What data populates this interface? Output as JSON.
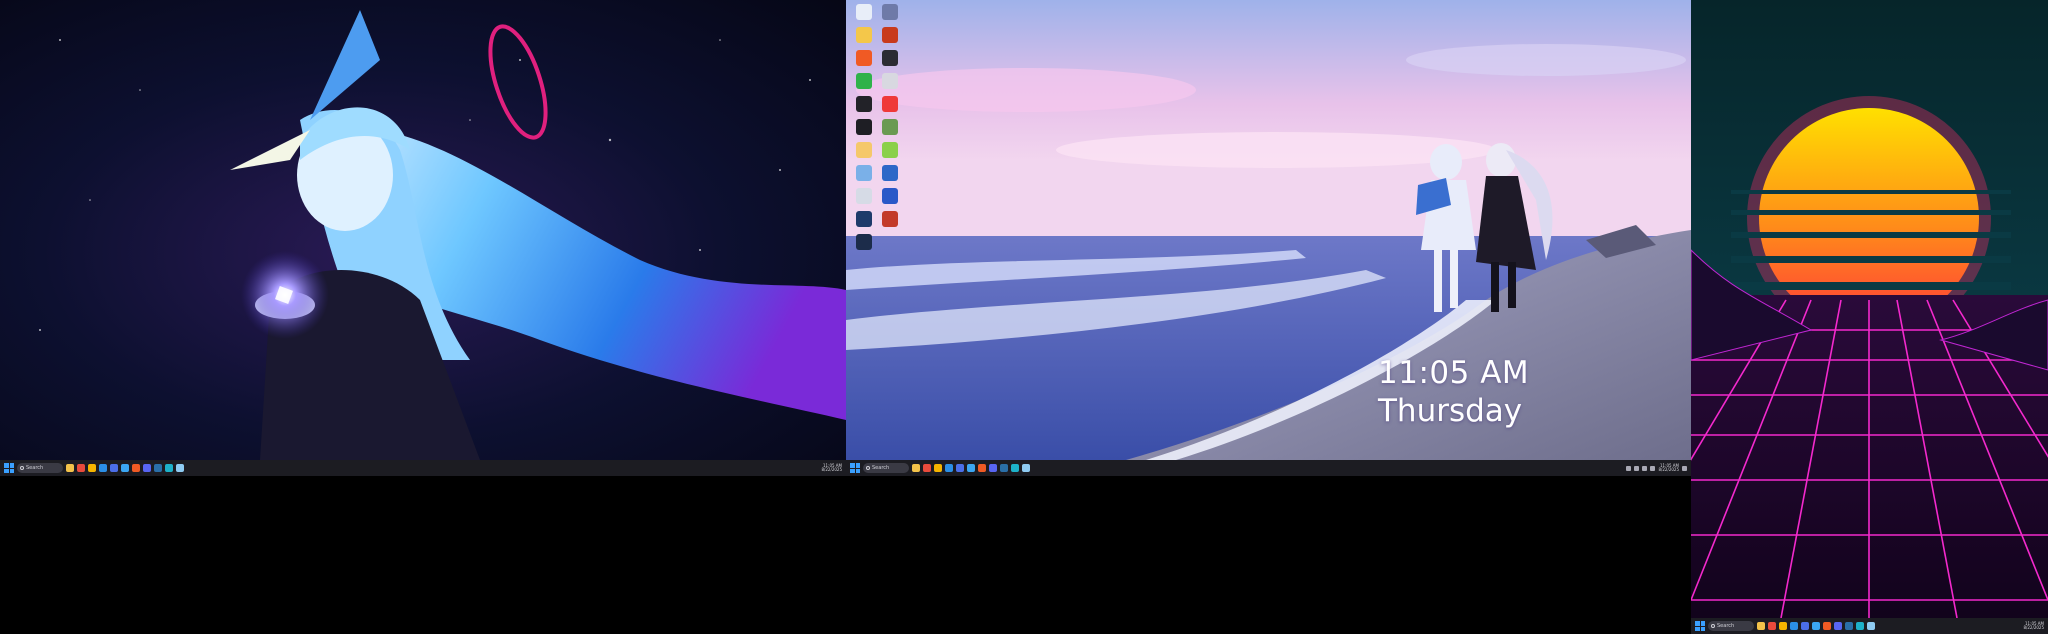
{
  "colors": {
    "taskbar": "#1c1c22",
    "accent": "#3aa0ff",
    "halo": "#e0207e",
    "sun_top": "#ffe000",
    "sun_bottom": "#ff3a3a",
    "grid": "#ff2bd6"
  },
  "monitors": {
    "left": {
      "taskbar": {
        "search_placeholder": "Search",
        "time": "11:05 AM",
        "date": "8/22/2025",
        "pinned": [
          {
            "name": "file-explorer-icon",
            "color": "#f3c24a"
          },
          {
            "name": "chrome-icon",
            "color": "#e94b3c"
          },
          {
            "name": "folder-icon",
            "color": "#f5b400"
          },
          {
            "name": "vscode-icon",
            "color": "#2b8fe6"
          },
          {
            "name": "mail-icon",
            "color": "#4b6ee8"
          },
          {
            "name": "photos-icon",
            "color": "#3ba6f2"
          },
          {
            "name": "brave-icon",
            "color": "#f05a24"
          },
          {
            "name": "discord-icon",
            "color": "#5865f2"
          },
          {
            "name": "steam-icon",
            "color": "#2a6fa8"
          },
          {
            "name": "edge-icon",
            "color": "#1db1c9"
          },
          {
            "name": "notepad-icon",
            "color": "#8ecbf2"
          }
        ]
      }
    },
    "middle": {
      "taskbar": {
        "search_placeholder": "Search",
        "time": "11:05 AM",
        "date": "8/22/2025",
        "pinned": [
          {
            "name": "file-explorer-icon",
            "color": "#f3c24a"
          },
          {
            "name": "chrome-icon",
            "color": "#e94b3c"
          },
          {
            "name": "folder-icon",
            "color": "#f5b400"
          },
          {
            "name": "vscode-icon",
            "color": "#2b8fe6"
          },
          {
            "name": "mail-icon",
            "color": "#4b6ee8"
          },
          {
            "name": "photos-icon",
            "color": "#3ba6f2"
          },
          {
            "name": "brave-icon",
            "color": "#f05a24"
          },
          {
            "name": "discord-icon",
            "color": "#5865f2"
          },
          {
            "name": "steam-icon",
            "color": "#2a6fa8"
          },
          {
            "name": "edge-icon",
            "color": "#1db1c9"
          },
          {
            "name": "notepad-icon",
            "color": "#8ecbf2"
          }
        ]
      },
      "desktop_icons": [
        {
          "name": "recycle-bin-icon",
          "color": "#e8eef8"
        },
        {
          "name": "app-icon",
          "color": "#6e7aa8"
        },
        {
          "name": "smiley-app-icon",
          "color": "#f4c74a"
        },
        {
          "name": "game-icon",
          "color": "#c83a1c"
        },
        {
          "name": "brave-icon",
          "color": "#f05a24"
        },
        {
          "name": "obs-icon",
          "color": "#2b2b33"
        },
        {
          "name": "app-green-icon",
          "color": "#2fb24a"
        },
        {
          "name": "character-icon",
          "color": "#d8d8e0"
        },
        {
          "name": "app-dark-icon",
          "color": "#222228"
        },
        {
          "name": "vivaldi-icon",
          "color": "#ef3939"
        },
        {
          "name": "app-gray-icon",
          "color": "#1e1e24"
        },
        {
          "name": "app-multi-icon",
          "color": "#6a9a52"
        },
        {
          "name": "folder-icon",
          "color": "#f5c86a"
        },
        {
          "name": "app-leaf-icon",
          "color": "#8ad04a"
        },
        {
          "name": "drive-icon",
          "color": "#7ab0e8"
        },
        {
          "name": "monitor-icon",
          "color": "#2d68c8"
        },
        {
          "name": "disk-icon",
          "color": "#d6dbe6"
        },
        {
          "name": "shield-icon",
          "color": "#2a58c8"
        },
        {
          "name": "app-blue-icon",
          "color": "#1e3a6a"
        },
        {
          "name": "app-red-icon",
          "color": "#c33a2a"
        },
        {
          "name": "app-navy-icon",
          "color": "#1c2c4a"
        }
      ],
      "clock_widget": {
        "time": "11:05 AM",
        "day": "Thursday"
      }
    },
    "right": {
      "taskbar": {
        "search_placeholder": "Search",
        "time": "11:05 AM",
        "date": "8/22/2025",
        "pinned": [
          {
            "name": "file-explorer-icon",
            "color": "#f3c24a"
          },
          {
            "name": "chrome-icon",
            "color": "#e94b3c"
          },
          {
            "name": "folder-icon",
            "color": "#f5b400"
          },
          {
            "name": "vscode-icon",
            "color": "#2b8fe6"
          },
          {
            "name": "mail-icon",
            "color": "#4b6ee8"
          },
          {
            "name": "photos-icon",
            "color": "#3ba6f2"
          },
          {
            "name": "brave-icon",
            "color": "#f05a24"
          },
          {
            "name": "discord-icon",
            "color": "#5865f2"
          },
          {
            "name": "steam-icon",
            "color": "#2a6fa8"
          },
          {
            "name": "edge-icon",
            "color": "#1db1c9"
          },
          {
            "name": "notepad-icon",
            "color": "#8ecbf2"
          }
        ]
      }
    }
  }
}
